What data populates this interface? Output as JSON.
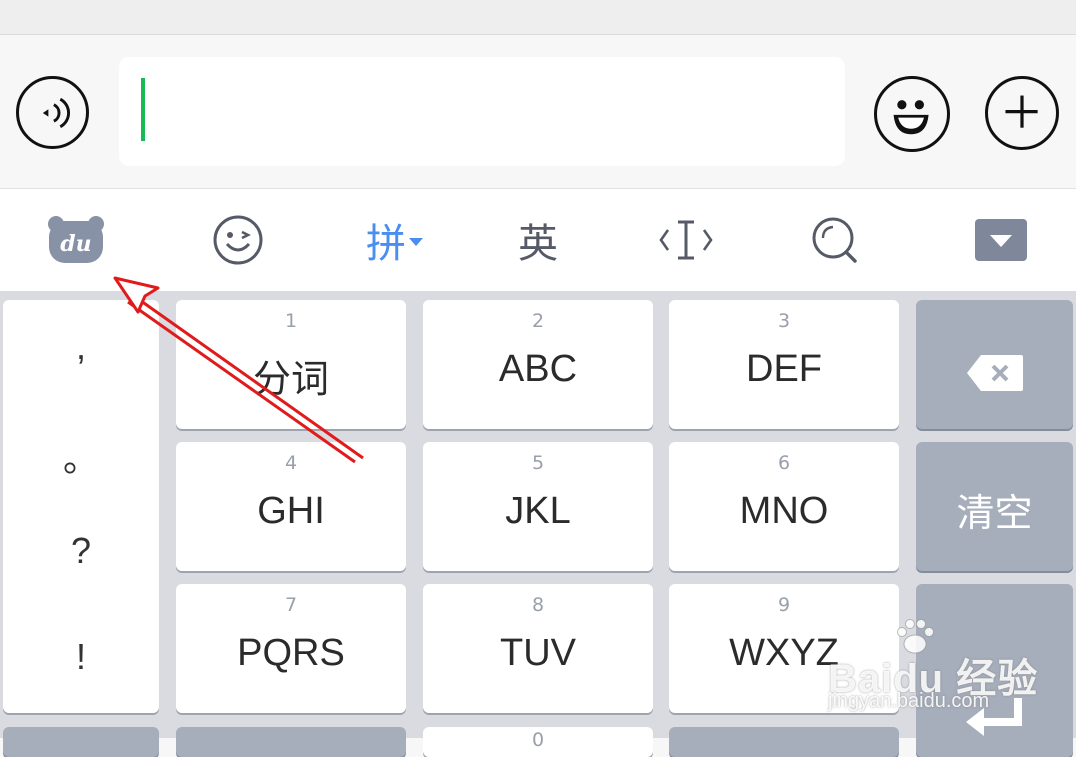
{
  "chat_bar": {
    "message_value": ""
  },
  "ime_toolbar": {
    "pinyin_label": "拼",
    "english_label": "英"
  },
  "keyboard": {
    "punctuation": [
      ",",
      "。",
      "?",
      "!"
    ],
    "keys": [
      {
        "num": "1",
        "letters": "分词"
      },
      {
        "num": "2",
        "letters": "ABC"
      },
      {
        "num": "3",
        "letters": "DEF"
      },
      {
        "num": "4",
        "letters": "GHI"
      },
      {
        "num": "5",
        "letters": "JKL"
      },
      {
        "num": "6",
        "letters": "MNO"
      },
      {
        "num": "7",
        "letters": "PQRS"
      },
      {
        "num": "8",
        "letters": "TUV"
      },
      {
        "num": "9",
        "letters": "WXYZ"
      },
      {
        "num": "0",
        "letters": ""
      }
    ],
    "clear_label": "清空"
  },
  "watermark": {
    "main": "Baidu 经验",
    "sub": "jingyan.baidu.com"
  },
  "colors": {
    "accent_pinyin": "#4a8ef0",
    "caret": "#19b955",
    "annotation_arrow": "#e01b1b",
    "function_key": "#a6adbb"
  }
}
